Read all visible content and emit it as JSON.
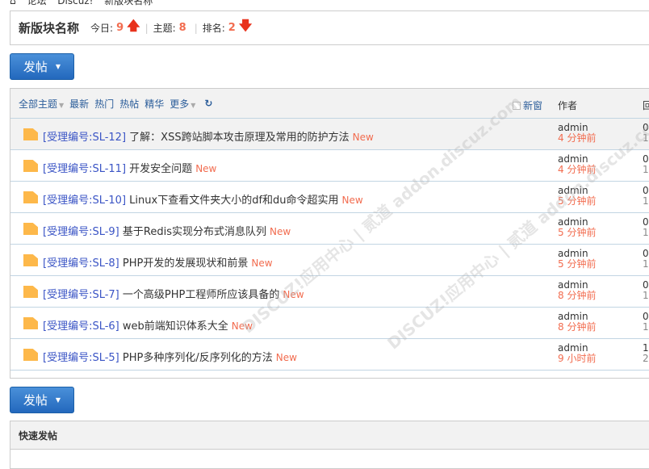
{
  "breadcrumb": [
    "⌂",
    "论坛",
    "Discuz!",
    "新版块名称"
  ],
  "header": {
    "title": "新版块名称",
    "today_label": "今日:",
    "today_value": "9",
    "threads_label": "主题:",
    "threads_value": "8",
    "rank_label": "排名:",
    "rank_value": "2"
  },
  "post_button": "发帖",
  "filters": {
    "all": "全部主题",
    "latest": "最新",
    "hot": "热门",
    "hot_posts": "热帖",
    "digest": "精华",
    "more": "更多",
    "new_window": "新窗",
    "author_col": "作者",
    "reply_col": "回"
  },
  "threads": [
    {
      "prefix": "[受理编号:SL-12]",
      "title": "了解：XSS跨站脚本攻击原理及常用的防护方法",
      "badge": "New",
      "author": "admin",
      "time": "4 分钟前",
      "replies": "0",
      "views": "1"
    },
    {
      "prefix": "[受理编号:SL-11]",
      "title": "开发安全问题",
      "badge": "New",
      "author": "admin",
      "time": "4 分钟前",
      "replies": "0",
      "views": "1"
    },
    {
      "prefix": "[受理编号:SL-10]",
      "title": "Linux下查看文件夹大小的df和du命令超实用",
      "badge": "New",
      "author": "admin",
      "time": "5 分钟前",
      "replies": "0",
      "views": "1"
    },
    {
      "prefix": "[受理编号:SL-9]",
      "title": "基于Redis实现分布式消息队列",
      "badge": "New",
      "author": "admin",
      "time": "5 分钟前",
      "replies": "0",
      "views": "1"
    },
    {
      "prefix": "[受理编号:SL-8]",
      "title": "PHP开发的发展现状和前景",
      "badge": "New",
      "author": "admin",
      "time": "5 分钟前",
      "replies": "0",
      "views": "1"
    },
    {
      "prefix": "[受理编号:SL-7]",
      "title": "一个高级PHP工程师所应该具备的",
      "badge": "New",
      "author": "admin",
      "time": "8 分钟前",
      "replies": "0",
      "views": "1"
    },
    {
      "prefix": "[受理编号:SL-6]",
      "title": "web前端知识体系大全",
      "badge": "New",
      "author": "admin",
      "time": "8 分钟前",
      "replies": "0",
      "views": "1"
    },
    {
      "prefix": "[受理编号:SL-5]",
      "title": "PHP多种序列化/反序列化的方法",
      "badge": "New",
      "author": "admin",
      "time": "9 小时前",
      "replies": "1",
      "views": "2"
    }
  ],
  "quick_post": {
    "title": "快速发帖"
  },
  "watermark": "DISCUZ!应用中心 | 贰道 addon.discuz.com",
  "colors": {
    "accent": "#2368bd",
    "highlight": "#f26c4f",
    "link": "#2b5d9a"
  }
}
